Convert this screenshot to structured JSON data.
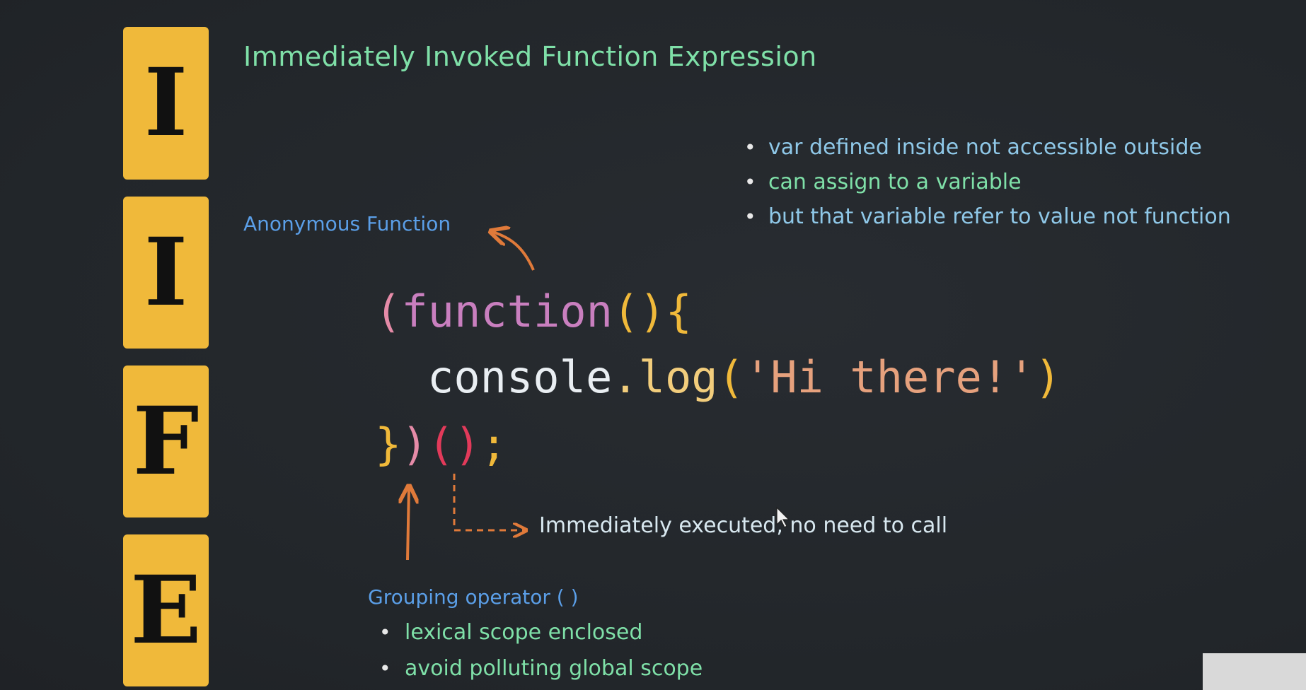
{
  "letters": [
    "I",
    "I",
    "F",
    "E"
  ],
  "title": "Immediately Invoked Function Expression",
  "top_bullets": [
    {
      "text": "var defined inside not accessible outside",
      "color": "#8fc8e8"
    },
    {
      "text": "can assign to a variable",
      "color": "#7fe0a8"
    },
    {
      "text": "but that variable refer to value not function",
      "color": "#8fc8e8"
    }
  ],
  "anonymous_label": "Anonymous Function",
  "code": {
    "line1": {
      "open_paren": "(",
      "keyword": "function",
      "parens": "()",
      "brace": "{"
    },
    "line2": {
      "object": "console",
      "dot": ".",
      "method": "log",
      "open": "(",
      "string": "'Hi there!'",
      "close": ")"
    },
    "line3": {
      "brace": "}",
      "close_paren": ")",
      "invoke": "()",
      "semicolon": ";"
    }
  },
  "exec_label": "Immediately executed, no need to call",
  "grouping_label": "Grouping operator ( )",
  "bottom_bullets": [
    "lexical scope enclosed",
    "avoid polluting global scope"
  ],
  "colors": {
    "background": "#23272c",
    "tile": "#f0b93a",
    "title": "#7fe0a8",
    "label_blue": "#5b9fe8",
    "arrow_orange": "#e07a3a"
  }
}
